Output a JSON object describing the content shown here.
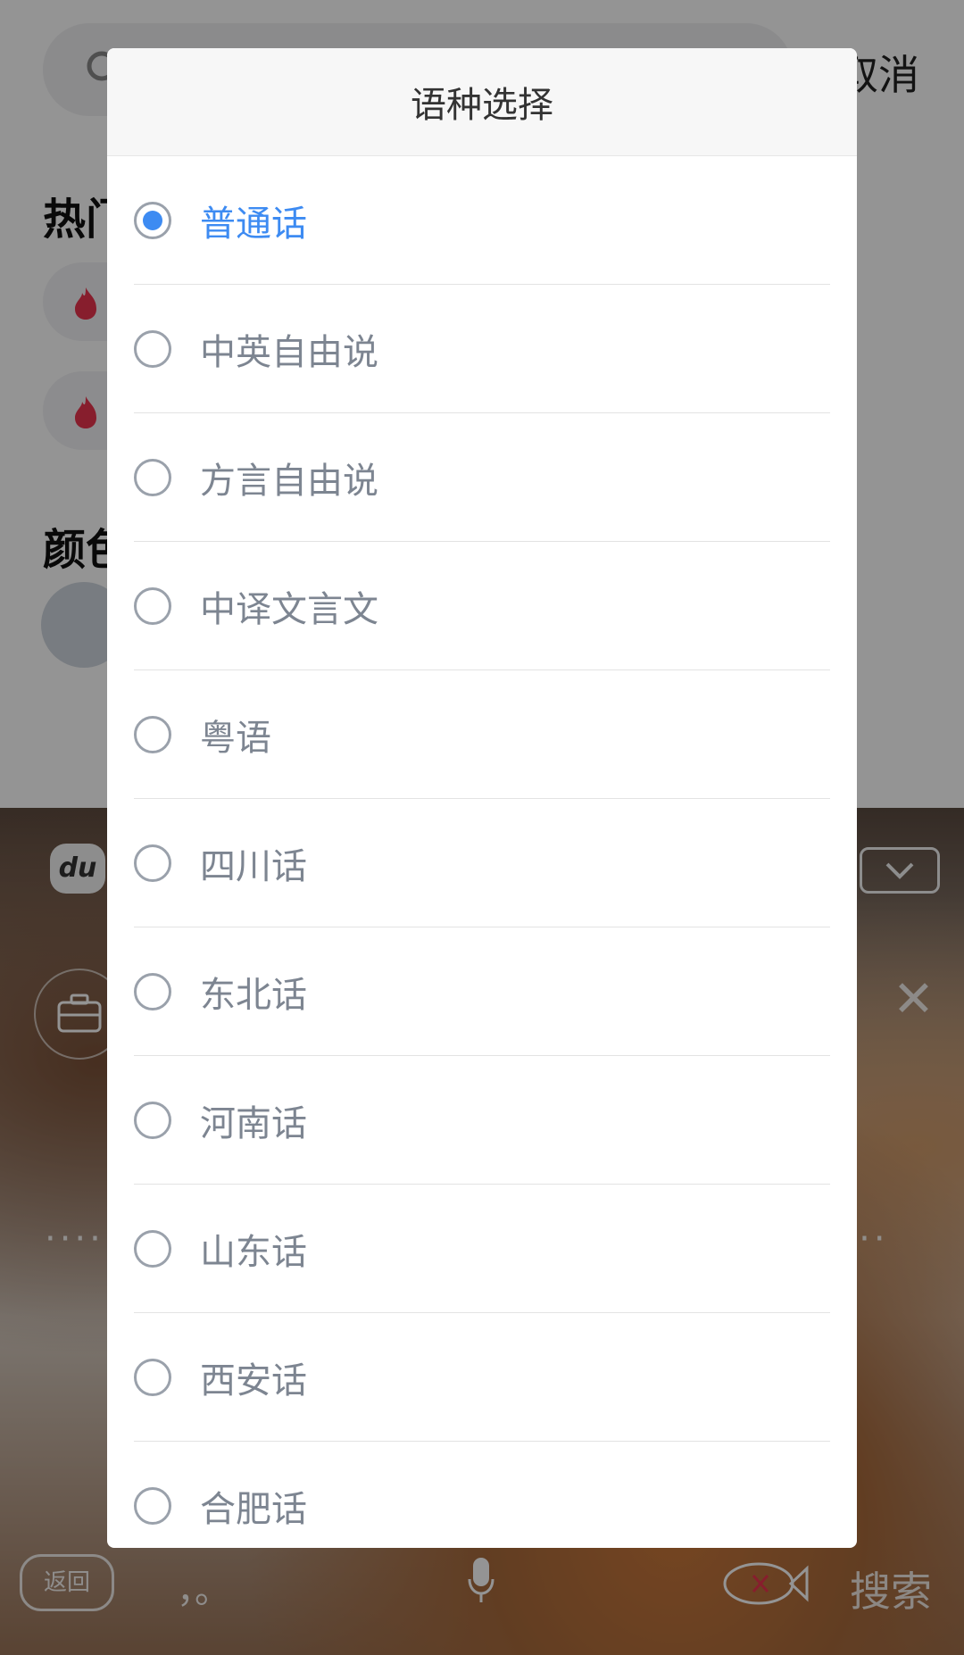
{
  "background_page": {
    "cancel_label": "取消",
    "hot_section_title": "热门",
    "color_section_title": "颜色"
  },
  "keyboard": {
    "logo_text": "du",
    "return_label": "返回",
    "punct_label": "，。",
    "search_label": "搜索",
    "dots_left": "·····",
    "dots_right": "·····"
  },
  "dialog": {
    "title": "语种选择",
    "selected_color": "#3d8bf2",
    "options": [
      {
        "label": "普通话",
        "selected": true
      },
      {
        "label": "中英自由说",
        "selected": false
      },
      {
        "label": "方言自由说",
        "selected": false
      },
      {
        "label": "中译文言文",
        "selected": false
      },
      {
        "label": "粤语",
        "selected": false
      },
      {
        "label": "四川话",
        "selected": false
      },
      {
        "label": "东北话",
        "selected": false
      },
      {
        "label": "河南话",
        "selected": false
      },
      {
        "label": "山东话",
        "selected": false
      },
      {
        "label": "西安话",
        "selected": false
      },
      {
        "label": "合肥话",
        "selected": false
      }
    ]
  }
}
